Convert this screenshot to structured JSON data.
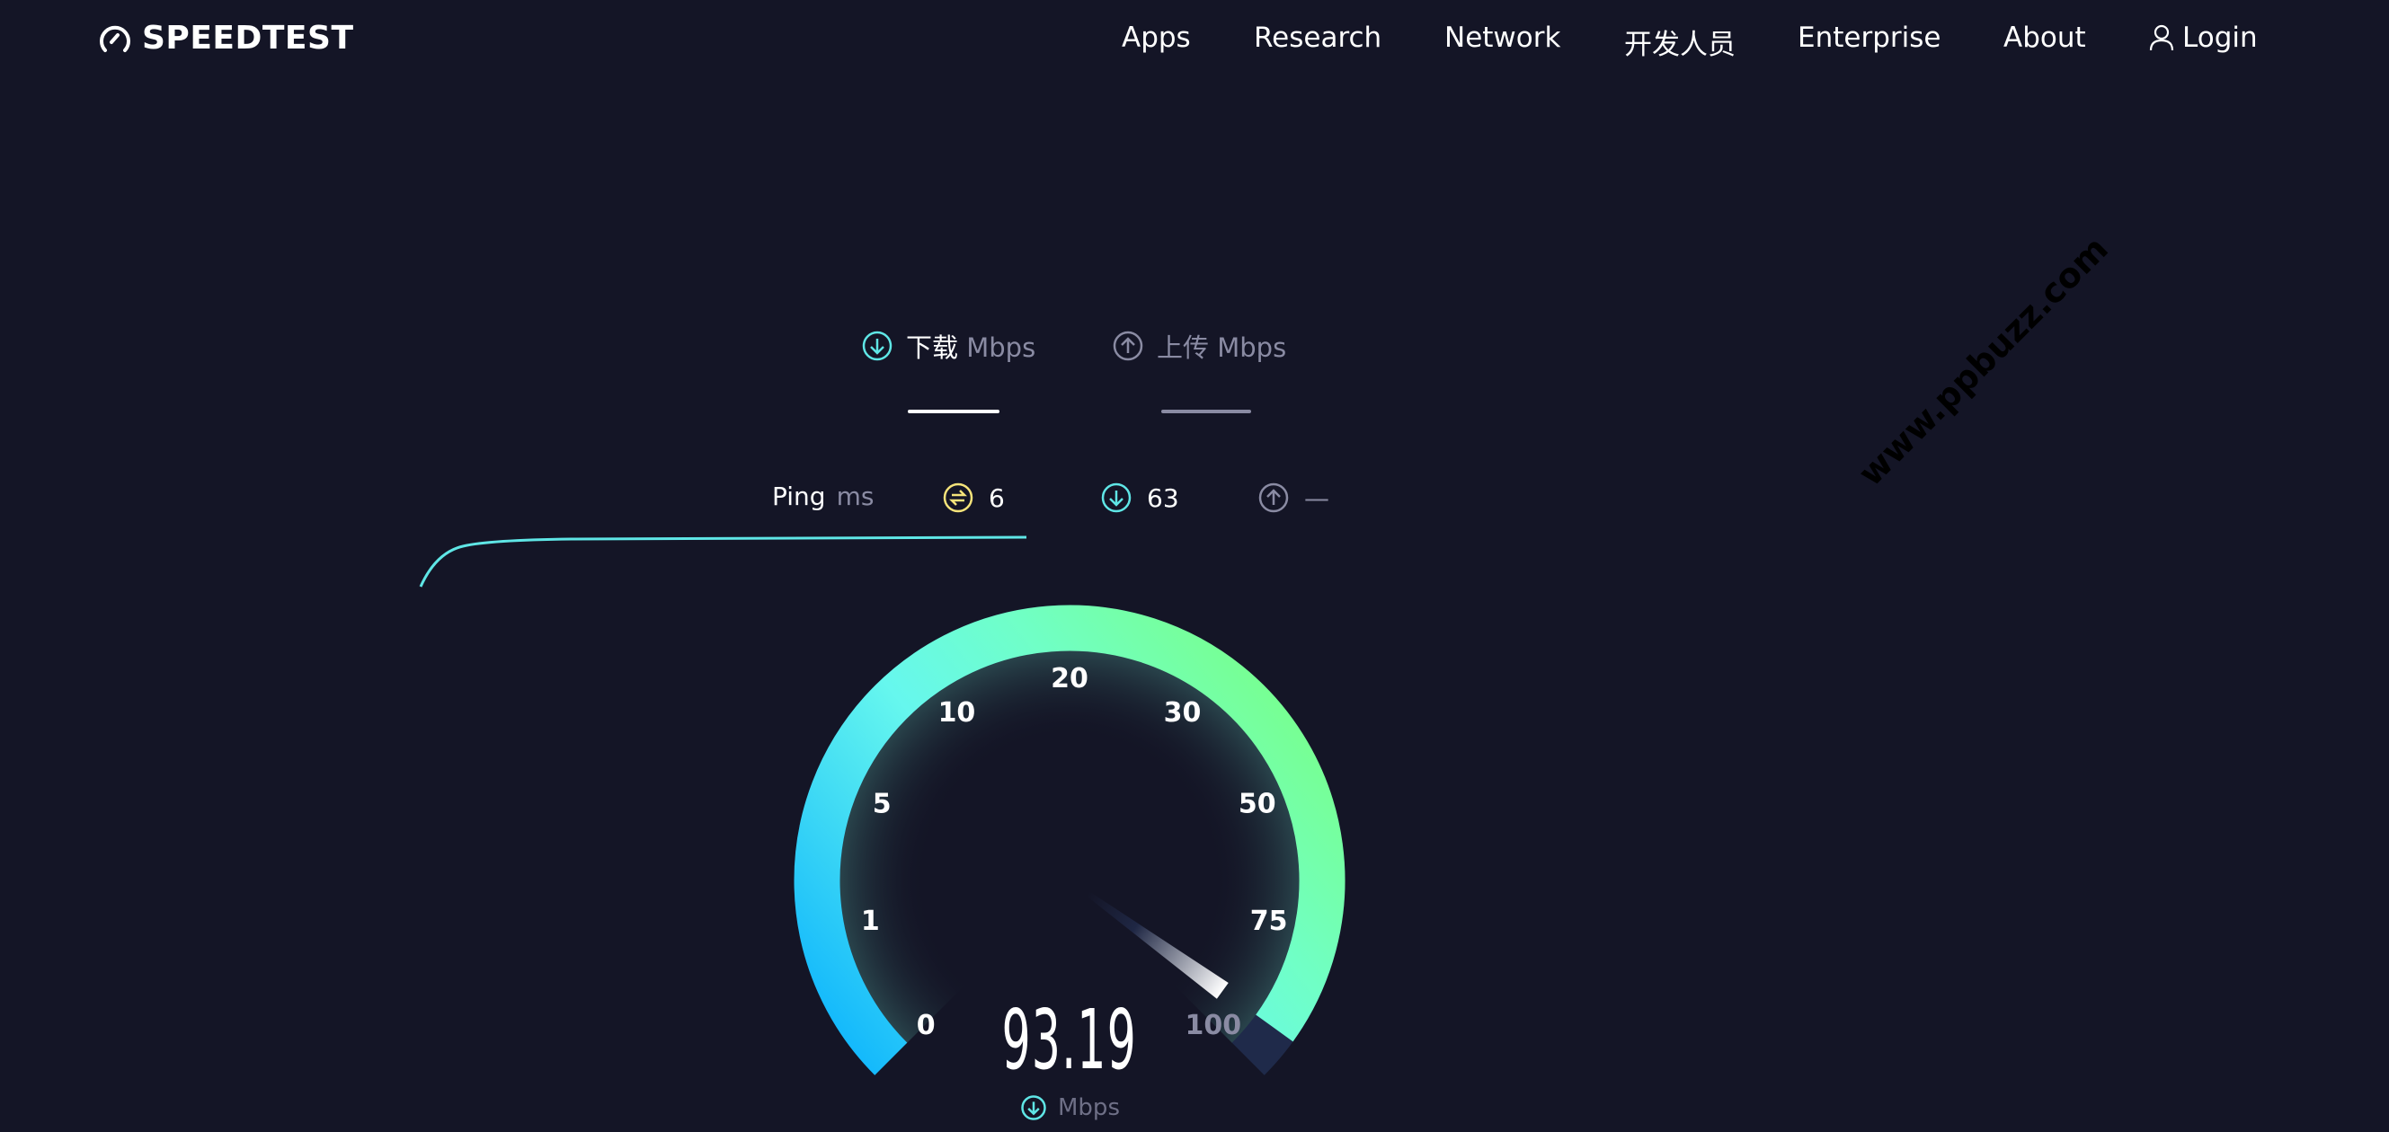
{
  "header": {
    "logo_text": "SPEEDTEST",
    "logo_icon": "speedometer-icon",
    "nav": [
      {
        "label": "Apps"
      },
      {
        "label": "Research"
      },
      {
        "label": "Network"
      },
      {
        "label": "开发人员"
      },
      {
        "label": "Enterprise"
      },
      {
        "label": "About"
      },
      {
        "label": "Login",
        "icon": "user-icon"
      }
    ]
  },
  "tabs": [
    {
      "label": "下载",
      "unit": "Mbps",
      "icon": "download-icon",
      "active": true
    },
    {
      "label": "上传",
      "unit": "Mbps",
      "icon": "upload-icon",
      "active": false
    }
  ],
  "ping_row": {
    "label": "Ping",
    "unit": "ms",
    "ping": {
      "icon": "ping-icon",
      "value": "6"
    },
    "download": {
      "icon": "download-icon",
      "value": "63"
    },
    "upload": {
      "icon": "upload-icon",
      "value": "—"
    }
  },
  "gauge": {
    "value": 93.19,
    "value_text": "93.19",
    "unit": "Mbps",
    "ticks": [
      "0",
      "1",
      "5",
      "10",
      "20",
      "30",
      "50",
      "75",
      "100"
    ],
    "tick_values": [
      0,
      1,
      5,
      10,
      20,
      30,
      50,
      75,
      100
    ]
  },
  "watermark": "www.ppbuzz.com",
  "colors": {
    "background": "#141526",
    "download": "#5fe6e6",
    "ping": "#f5e37a",
    "upload": "#8a8ba3",
    "gauge_start": "#00aaff",
    "gauge_mid": "#6cffe0",
    "gauge_end": "#7cff72",
    "gauge_unfilled": "#1f2a4a"
  }
}
